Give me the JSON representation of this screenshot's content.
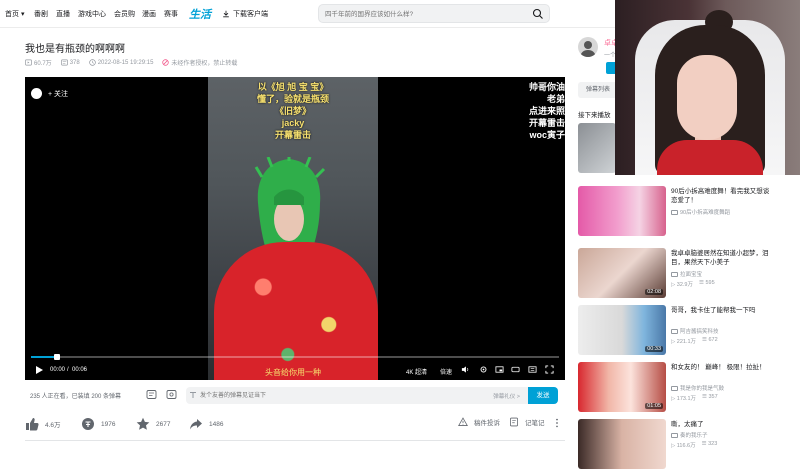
{
  "nav": {
    "home": "首页",
    "items": [
      "番剧",
      "直播",
      "游戏中心",
      "会员购",
      "漫画",
      "赛事"
    ],
    "logo": "生活",
    "download": "下载客户端",
    "search_placeholder": "四千年前的国界应该如什么样?"
  },
  "video": {
    "title": "我也是有瓶颈的啊啊啊",
    "views": "60.7万",
    "danmaku": "378",
    "date": "2022-08-15 19:29:15",
    "notice": "未经作者授权，禁止转载"
  },
  "player": {
    "follow": "关注",
    "overlay_lines": [
      "以《旭 旭 宝 宝》",
      "懂了，验就是瓶颈",
      "《旧梦》",
      "jacky",
      "开幕雷击"
    ],
    "right_overlay": [
      "帅哥你油",
      "老弟",
      "点进来照",
      "开幕雷击",
      "woc寅子"
    ],
    "bottom_caption": "头音给你用一种",
    "time_current": "00:00",
    "time_total": "00:06",
    "progress": 0.05,
    "quality": "4K 超清",
    "speed": "倍速"
  },
  "danmaku_bar": {
    "count": "235 人正在看，已装填 200 条弹幕",
    "placeholder": "发个友善的弹幕见证当下",
    "etiquette": "弹幕礼仪 >",
    "send": "发送"
  },
  "actions": {
    "like": "4.6万",
    "coin": "1976",
    "favorite": "2677",
    "share": "1486",
    "report": "稿件投诉",
    "notes": "记笔记"
  },
  "sidebar": {
    "up_name": "卓卓",
    "up_desc": "一个...",
    "danmaku_list": "弹幕列表",
    "next_label": "接下来播放",
    "recommendations": [
      {
        "title": "90后小拆高难度舞！看完我又想谈恋爱了！",
        "up": "90后小拆高难度舞蹈",
        "views": "",
        "danmaku": "",
        "duration": ""
      },
      {
        "title": "我卓卓脑婆居然在知道小超梦，泪目，果然天下小美子",
        "up": "拉面宝宝",
        "views": "32.9万",
        "danmaku": "595",
        "duration": "02:08"
      },
      {
        "title": "哥哥，我卡住了能帮我一下吗",
        "up": "阿吉酱搞笑科技",
        "views": "221.1万",
        "danmaku": "672",
        "duration": "00:33"
      },
      {
        "title": "和女友的！ 巅峰！ 极限！拉扯！",
        "up": "我是你的我是气鼓",
        "views": "173.1万",
        "danmaku": "357",
        "duration": "01:05"
      },
      {
        "title": "嘶，太痛了",
        "up": "奏的我乐子",
        "views": "116.6万",
        "danmaku": "323",
        "duration": ""
      }
    ]
  },
  "colors": {
    "accent": "#00a1d6",
    "pink": "#fb7299",
    "text": "#18191c",
    "muted": "#9499a0"
  }
}
